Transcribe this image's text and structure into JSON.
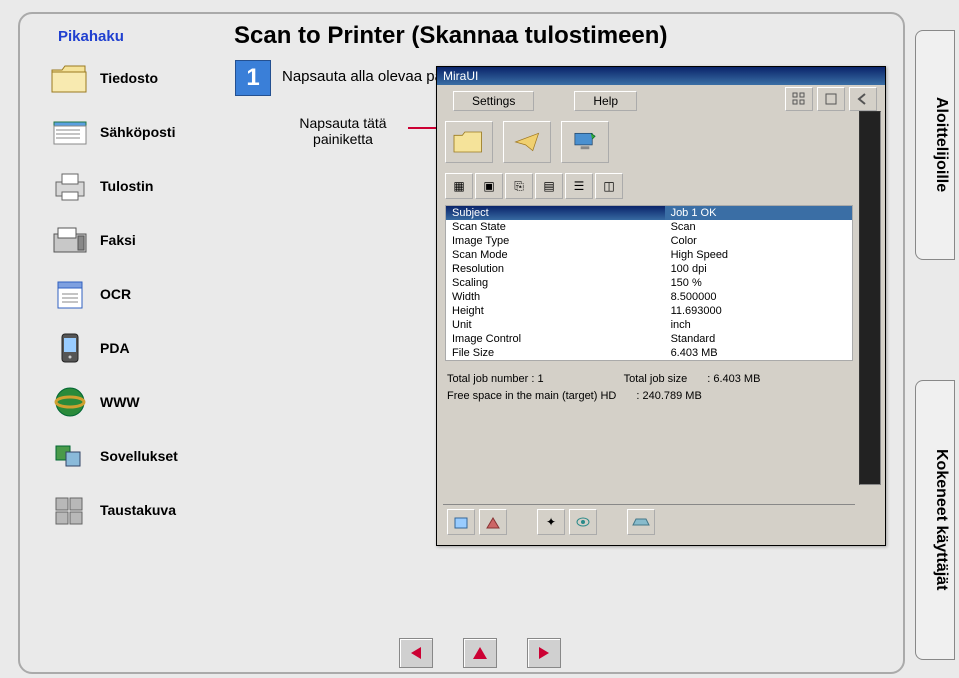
{
  "pikahaku": "Pikahaku",
  "title": "Scan to Printer (Skannaa tulostimeen)",
  "step": {
    "num": "1",
    "text": "Napsauta alla olevaa painiketta."
  },
  "callout": "Napsauta tätä painiketta",
  "sidebar": [
    {
      "label": "Tiedosto"
    },
    {
      "label": "Sähköposti"
    },
    {
      "label": "Tulostin"
    },
    {
      "label": "Faksi"
    },
    {
      "label": "OCR"
    },
    {
      "label": "PDA"
    },
    {
      "label": "WWW"
    },
    {
      "label": "Sovellukset"
    },
    {
      "label": "Taustakuva"
    }
  ],
  "vtab": {
    "top": "Aloittelijoille",
    "bot": "Kokeneet käyttäjät"
  },
  "win": {
    "title": "MiraUI",
    "menu": {
      "settings": "Settings",
      "help": "Help"
    },
    "table": [
      [
        "Subject",
        "Job 1  OK"
      ],
      [
        "Scan State",
        "Scan"
      ],
      [
        "Image Type",
        "Color"
      ],
      [
        "Scan Mode",
        "High Speed"
      ],
      [
        "Resolution",
        "100 dpi"
      ],
      [
        "Scaling",
        "150 %"
      ],
      [
        "Width",
        "8.500000"
      ],
      [
        "Height",
        "11.693000"
      ],
      [
        "Unit",
        "inch"
      ],
      [
        "Image Control",
        "Standard"
      ],
      [
        "File Size",
        "6.403  MB"
      ]
    ],
    "status": {
      "l1a": "Total job number :  1",
      "l1b": "Total job size",
      "l1c": ":  6.403  MB",
      "l2a": "Free space in the main (target) HD",
      "l2b": ":  240.789 MB"
    }
  }
}
